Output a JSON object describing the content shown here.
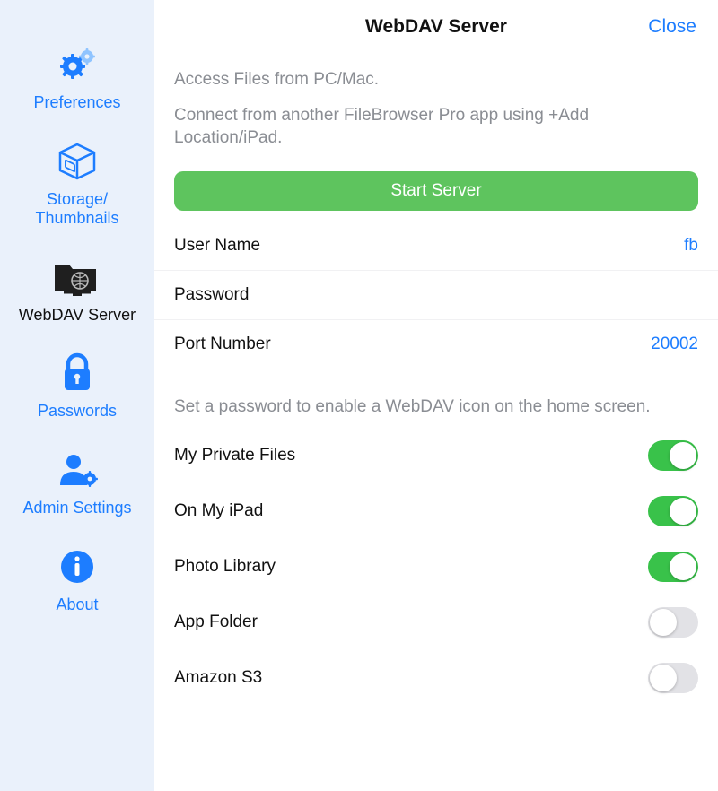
{
  "sidebar": {
    "items": [
      {
        "id": "preferences",
        "label": "Preferences"
      },
      {
        "id": "storage",
        "label": "Storage/\nThumbnails"
      },
      {
        "id": "webdav",
        "label": "WebDAV Server"
      },
      {
        "id": "passwords",
        "label": "Passwords"
      },
      {
        "id": "admin",
        "label": "Admin Settings"
      },
      {
        "id": "about",
        "label": "About"
      }
    ]
  },
  "header": {
    "title": "WebDAV Server",
    "close": "Close"
  },
  "intro": {
    "line1": "Access Files from PC/Mac.",
    "line2": "Connect from another FileBrowser Pro app using +Add Location/iPad."
  },
  "start_button": "Start Server",
  "fields": {
    "username_label": "User Name",
    "username_value": "fb",
    "password_label": "Password",
    "password_value": "",
    "port_label": "Port Number",
    "port_value": "20002"
  },
  "note": "Set a password to enable a WebDAV icon on the home screen.",
  "shares": [
    {
      "label": "My Private Files",
      "on": true
    },
    {
      "label": "On My iPad",
      "on": true
    },
    {
      "label": "Photo Library",
      "on": true
    },
    {
      "label": "App Folder",
      "on": false
    },
    {
      "label": "Amazon S3",
      "on": false
    }
  ],
  "colors": {
    "accent": "#1d7dff",
    "green": "#5ec45e",
    "toggle_on": "#39c24a"
  }
}
